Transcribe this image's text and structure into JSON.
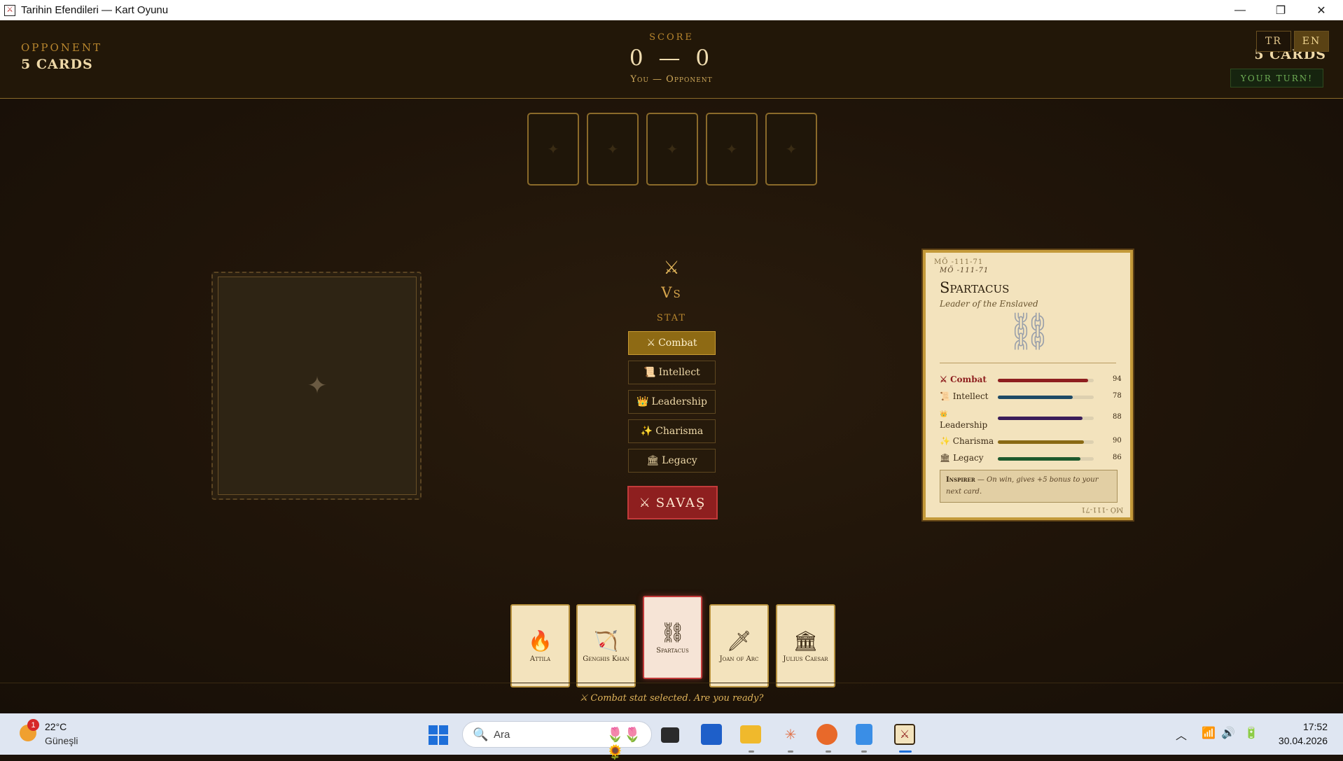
{
  "window": {
    "title": "Tarihin Efendileri — Kart Oyunu",
    "minimize": "—",
    "maximize": "❐",
    "close": "✕"
  },
  "header": {
    "opponent_label": "OPPONENT",
    "opponent_cards": "5 CARDS",
    "score_label": "SCORE",
    "score": "0 — 0",
    "score_sub": "You — Opponent",
    "my_cards": "5 CARDS",
    "lang_tr": "TR",
    "lang_en": "EN",
    "active_lang": "EN",
    "turn": "YOUR TURN!"
  },
  "opponent_hand": [
    "✦",
    "✦",
    "✦",
    "✦",
    "✦"
  ],
  "arena": {
    "empty_slot_icon": "✦",
    "vs_icon": "⚔",
    "vs_label": "Vs",
    "stat_label": "STAT",
    "stats": [
      {
        "icon": "⚔",
        "label": "Combat",
        "selected": true
      },
      {
        "icon": "📜",
        "label": "Intellect",
        "selected": false
      },
      {
        "icon": "👑",
        "label": "Leadership",
        "selected": false
      },
      {
        "icon": "✨",
        "label": "Charisma",
        "selected": false
      },
      {
        "icon": "🏛",
        "label": "Legacy",
        "selected": false
      }
    ],
    "battle_icon": "⚔",
    "battle_label": "SAVAŞ"
  },
  "detail_card": {
    "era_top": "MÖ -111-71",
    "era_sub": "MÖ -111-71",
    "name": "Spartacus",
    "epithet": "Leader of the Enslaved",
    "portrait_icon": "⛓",
    "stats": [
      {
        "icon": "⚔",
        "label": "Combat",
        "value": 94,
        "color": "#8e1f1f"
      },
      {
        "icon": "📜",
        "label": "Intellect",
        "value": 78,
        "color": "#1e4a66"
      },
      {
        "icon": "👑",
        "label": "Leadership",
        "value": 88,
        "color": "#3a1d5a"
      },
      {
        "icon": "✨",
        "label": "Charisma",
        "value": 90,
        "color": "#8a6a14"
      },
      {
        "icon": "🏛",
        "label": "Legacy",
        "value": 86,
        "color": "#1f5a2e"
      }
    ],
    "ability_name": "Inspirer",
    "ability_sep": " — ",
    "ability_text": "On win, gives +5 bonus to your next card.",
    "era_bottom": "MÖ -111-71"
  },
  "hand": [
    {
      "icon": "🔥",
      "name": "Attila"
    },
    {
      "icon": "🏹",
      "name": "Genghis Khan"
    },
    {
      "icon": "⛓",
      "name": "Spartacus"
    },
    {
      "icon": "🗡",
      "name": "Joan of Arc"
    },
    {
      "icon": "🏛",
      "name": "Julius Caesar"
    }
  ],
  "status": "⚔ Combat stat selected. Are you ready?",
  "taskbar": {
    "weather_badge": "1",
    "temperature": "22°C",
    "condition": "Güneşli",
    "search_placeholder": "Ara",
    "search_icon": "🔍",
    "flowers": "🌷🌷🌻",
    "time": "17:52",
    "date": "30.04.2026",
    "tray_chevron": "︿",
    "tray_wifi": "📶",
    "tray_volume": "🔊",
    "tray_battery": "🔋"
  },
  "colors": {
    "accent_gold": "#c99b33",
    "battle_red": "#8e1f1f",
    "card_cream": "#f3e3bd",
    "background": "#1c1209"
  }
}
